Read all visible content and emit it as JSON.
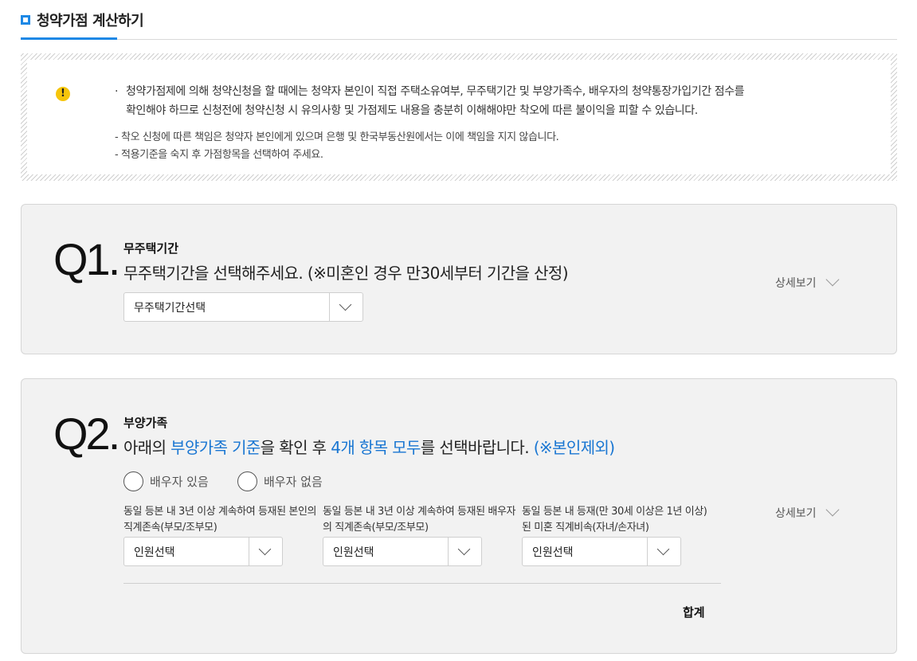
{
  "header": {
    "title": "청약가점 계산하기"
  },
  "notice": {
    "line1": "청약가점제에 의해 청약신청을 할 때에는 청약자 본인이 직접 주택소유여부, 무주택기간 및 부양가족수, 배우자의 청약통장가입기간 점수를",
    "line2": "확인해야 하므로 신청전에 청약신청 시 유의사항 및 가점제도 내용을 충분히 이해해야만 착오에 따른 불이익을 피할 수 있습니다.",
    "sub1": "- 착오 신청에 따른 책임은 청약자 본인에게 있으며 은행 및 한국부동산원에서는 이에 책임을 지지 않습니다.",
    "sub2": "- 적용기준을 숙지 후 가점항목을 선택하여 주세요.",
    "bullet": "·",
    "icon_glyph": "!"
  },
  "q1": {
    "number": "Q1.",
    "title": "무주택기간",
    "description": "무주택기간을 선택해주세요. (※미혼인 경우 만30세부터 기간을 산정)",
    "select_value": "무주택기간선택",
    "detail_label": "상세보기"
  },
  "q2": {
    "number": "Q2.",
    "title": "부양가족",
    "desc_part1": "아래의 ",
    "desc_link1": "부양가족 기준",
    "desc_part2": "을 확인 후 ",
    "desc_link2": "4개 항목 모두",
    "desc_part3": "를 선택바랍니다. ",
    "desc_link3": "(※본인제외)",
    "radio_spouse_yes": "배우자 있음",
    "radio_spouse_no": "배우자 없음",
    "dep1_label": "동일 등본 내 3년 이상 계속하여 등재된 본인의 직계존속(부모/조부모)",
    "dep2_label": "동일 등본 내 3년 이상 계속하여 등재된 배우자의 직계존속(부모/조부모)",
    "dep3_label": "동일 등본 내 등재(만 30세 이상은 1년 이상) 된 미혼 직계비속(자녀/손자녀)",
    "select_placeholder": "인원선택",
    "detail_label": "상세보기",
    "total_label": "합계"
  },
  "colors": {
    "accent": "#1e88e5",
    "link": "#1976d2",
    "warning": "#f6c50b"
  }
}
